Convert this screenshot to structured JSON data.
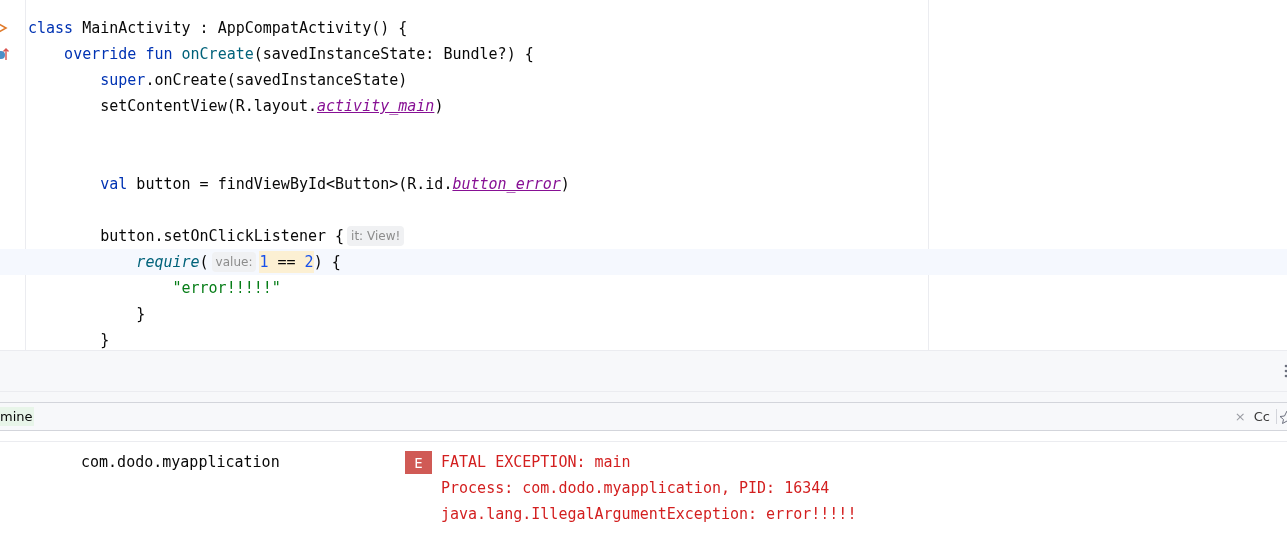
{
  "editor": {
    "lines": [
      {
        "kind": "code",
        "current": false,
        "gutter": {
          "kind": "class"
        },
        "tokens": [
          {
            "kind": "keyword",
            "text": "class"
          },
          {
            "kind": "plain",
            "text": " MainActivity : AppCompatActivity() {"
          }
        ]
      },
      {
        "kind": "code",
        "current": false,
        "gutter": {
          "kind": "override"
        },
        "tokens": [
          {
            "kind": "keyword",
            "text": "    override fun"
          },
          {
            "kind": "declaration",
            "text": " onCreate"
          },
          {
            "kind": "plain",
            "text": "(savedInstanceState: Bundle?) {"
          }
        ]
      },
      {
        "kind": "code",
        "current": false,
        "tokens": [
          {
            "kind": "keyword",
            "text": "        super"
          },
          {
            "kind": "plain",
            "text": ".onCreate(savedInstanceState)"
          }
        ]
      },
      {
        "kind": "code",
        "current": false,
        "tokens": [
          {
            "kind": "plain",
            "text": "        setContentView(R.layout."
          },
          {
            "kind": "reference",
            "text": "activity_main"
          },
          {
            "kind": "plain",
            "text": ")"
          }
        ]
      },
      {
        "kind": "blank",
        "current": false
      },
      {
        "kind": "blank",
        "current": false
      },
      {
        "kind": "code",
        "current": false,
        "tokens": [
          {
            "kind": "keyword",
            "text": "        val"
          },
          {
            "kind": "plain",
            "text": " button = findViewById<Button>(R.id."
          },
          {
            "kind": "reference",
            "text": "button_error"
          },
          {
            "kind": "plain",
            "text": ")"
          }
        ]
      },
      {
        "kind": "blank",
        "current": false
      },
      {
        "kind": "code",
        "current": false,
        "tokens": [
          {
            "kind": "plain",
            "text": "        button.setOnClickListener {"
          },
          {
            "kind": "hint",
            "text": "it: View!"
          }
        ]
      },
      {
        "kind": "code",
        "current": true,
        "tokens": [
          {
            "kind": "call",
            "text": "            require"
          },
          {
            "kind": "plain",
            "text": "("
          },
          {
            "kind": "hint",
            "text": "value:"
          },
          {
            "kind": "number",
            "text": "1",
            "highlighted": true
          },
          {
            "kind": "plain",
            "text": " == ",
            "highlighted": true
          },
          {
            "kind": "number",
            "text": "2",
            "highlighted": true
          },
          {
            "kind": "plain",
            "text": ") {"
          }
        ]
      },
      {
        "kind": "code",
        "current": false,
        "tokens": [
          {
            "kind": "string",
            "text": "                \"error!!!!!\""
          }
        ]
      },
      {
        "kind": "code",
        "current": false,
        "tokens": [
          {
            "kind": "plain",
            "text": "            }"
          }
        ]
      },
      {
        "kind": "code",
        "current": false,
        "tokens": [
          {
            "kind": "plain",
            "text": "        }"
          }
        ]
      }
    ]
  },
  "filter": {
    "value": "mine",
    "clear": "×",
    "match_case": "Cc"
  },
  "logcat": {
    "rows": [
      {
        "package": "com.dodo.myapplication",
        "level": "E",
        "messages": [
          "FATAL EXCEPTION: main",
          "Process: com.dodo.myapplication, PID: 16344",
          "java.lang.IllegalArgumentException: error!!!!!"
        ]
      }
    ]
  }
}
